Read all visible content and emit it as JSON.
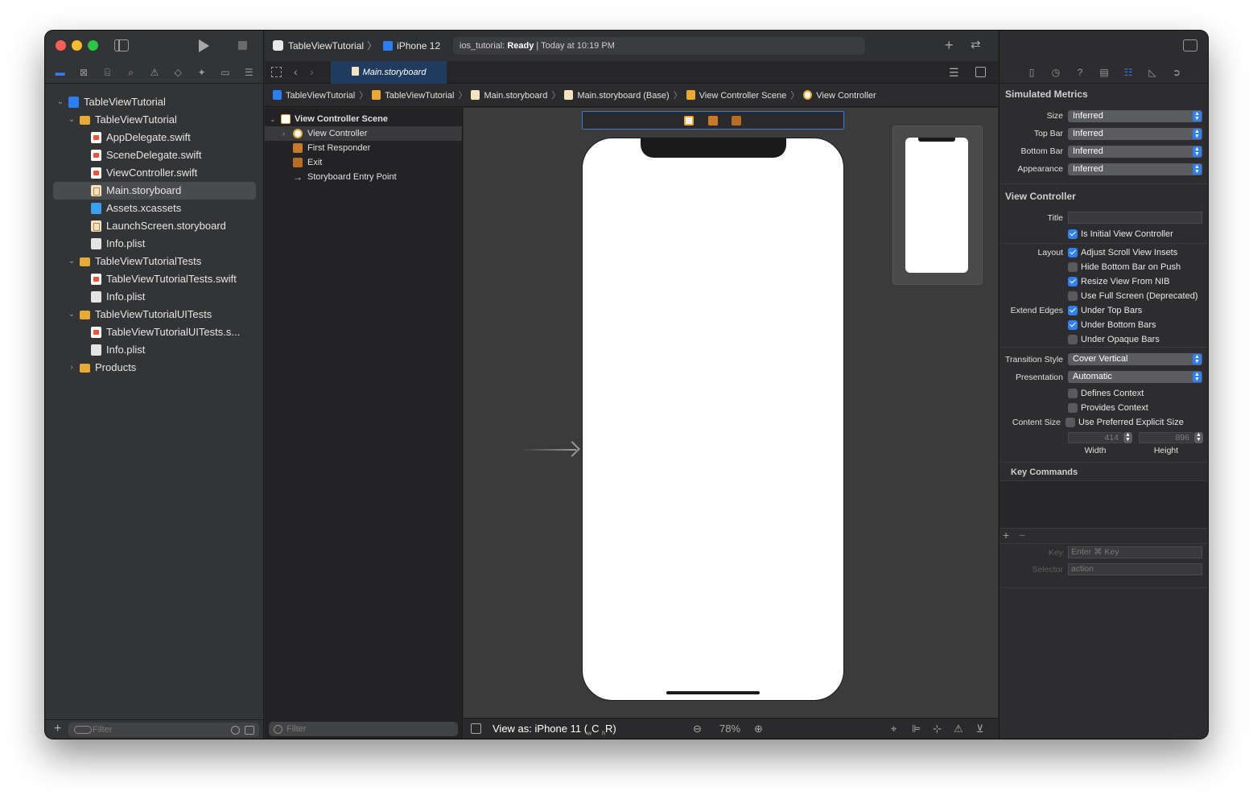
{
  "colors": {
    "accent": "#2f7ff5",
    "close": "#ff5f57",
    "minimize": "#febc2e",
    "zoom": "#28c840",
    "folder": "#e8a935",
    "canvas_bg": "#3b3b3b"
  },
  "navigator": {
    "icons": [
      "folder-icon",
      "source-control-icon",
      "symbol-icon",
      "find-icon",
      "issue-icon",
      "test-icon",
      "debug-icon",
      "breakpoint-icon",
      "report-icon"
    ],
    "tree": [
      {
        "label": "TableViewTutorial",
        "type": "project",
        "level": 0,
        "disclosure": "open"
      },
      {
        "label": "TableViewTutorial",
        "type": "folder",
        "level": 1,
        "disclosure": "open"
      },
      {
        "label": "AppDelegate.swift",
        "type": "swift",
        "level": 2
      },
      {
        "label": "SceneDelegate.swift",
        "type": "swift",
        "level": 2
      },
      {
        "label": "ViewController.swift",
        "type": "swift",
        "level": 2
      },
      {
        "label": "Main.storyboard",
        "type": "storyboard",
        "level": 2,
        "selected": true
      },
      {
        "label": "Assets.xcassets",
        "type": "assets",
        "level": 2
      },
      {
        "label": "LaunchScreen.storyboard",
        "type": "storyboard",
        "level": 2
      },
      {
        "label": "Info.plist",
        "type": "plist",
        "level": 2
      },
      {
        "label": "TableViewTutorialTests",
        "type": "folder",
        "level": 1,
        "disclosure": "open"
      },
      {
        "label": "TableViewTutorialTests.swift",
        "type": "swift",
        "level": 2
      },
      {
        "label": "Info.plist",
        "type": "plist",
        "level": 2
      },
      {
        "label": "TableViewTutorialUITests",
        "type": "folder",
        "level": 1,
        "disclosure": "open"
      },
      {
        "label": "TableViewTutorialUITests.s...",
        "type": "swift",
        "level": 2
      },
      {
        "label": "Info.plist",
        "type": "plist",
        "level": 2
      },
      {
        "label": "Products",
        "type": "folder",
        "level": 1,
        "disclosure": "closed"
      }
    ],
    "filter_placeholder": "Filter"
  },
  "toolbar": {
    "scheme": "TableViewTutorial",
    "device": "iPhone 12",
    "status_project": "ios_tutorial:",
    "status_state": "Ready",
    "status_time": "| Today at 10:19 PM"
  },
  "editor": {
    "tab_label": "Main.storyboard",
    "breadcrumbs": [
      "TableViewTutorial",
      "TableViewTutorial",
      "Main.storyboard",
      "Main.storyboard (Base)",
      "View Controller Scene",
      "View Controller"
    ]
  },
  "outline": {
    "scene_title": "View Controller Scene",
    "items": [
      "View Controller",
      "First Responder",
      "Exit",
      "Storyboard Entry Point"
    ],
    "filter_placeholder": "Filter"
  },
  "canvas_bar": {
    "view_as_prefix": "View as: iPhone 11 (",
    "size_class_w": "w",
    "size_class_w_val": "C",
    "size_class_h": "h",
    "size_class_h_val": "R)",
    "zoom": "78%"
  },
  "inspector": {
    "simulated_metrics": {
      "title": "Simulated Metrics",
      "fields": [
        {
          "label": "Size",
          "value": "Inferred"
        },
        {
          "label": "Top Bar",
          "value": "Inferred"
        },
        {
          "label": "Bottom Bar",
          "value": "Inferred"
        },
        {
          "label": "Appearance",
          "value": "Inferred"
        }
      ]
    },
    "view_controller": {
      "title": "View Controller",
      "title_label": "Title",
      "title_value": "",
      "is_initial": "Is Initial View Controller",
      "layout_label": "Layout",
      "layout_options": [
        {
          "label": "Adjust Scroll View Insets",
          "checked": true
        },
        {
          "label": "Hide Bottom Bar on Push",
          "checked": false
        },
        {
          "label": "Resize View From NIB",
          "checked": true
        },
        {
          "label": "Use Full Screen (Deprecated)",
          "checked": false
        }
      ],
      "extend_label": "Extend Edges",
      "extend_options": [
        {
          "label": "Under Top Bars",
          "checked": true
        },
        {
          "label": "Under Bottom Bars",
          "checked": true
        },
        {
          "label": "Under Opaque Bars",
          "checked": false
        }
      ],
      "transition_label": "Transition Style",
      "transition_value": "Cover Vertical",
      "presentation_label": "Presentation",
      "presentation_value": "Automatic",
      "defines_context": "Defines Context",
      "provides_context": "Provides Context",
      "content_size_label": "Content Size",
      "use_preferred": "Use Preferred Explicit Size",
      "width_value": "414",
      "height_value": "896",
      "width_label": "Width",
      "height_label": "Height"
    },
    "key_commands": {
      "title": "Key Commands",
      "key_label": "Key",
      "key_placeholder": "Enter ⌘ Key",
      "selector_label": "Selector",
      "selector_placeholder": "action"
    }
  }
}
